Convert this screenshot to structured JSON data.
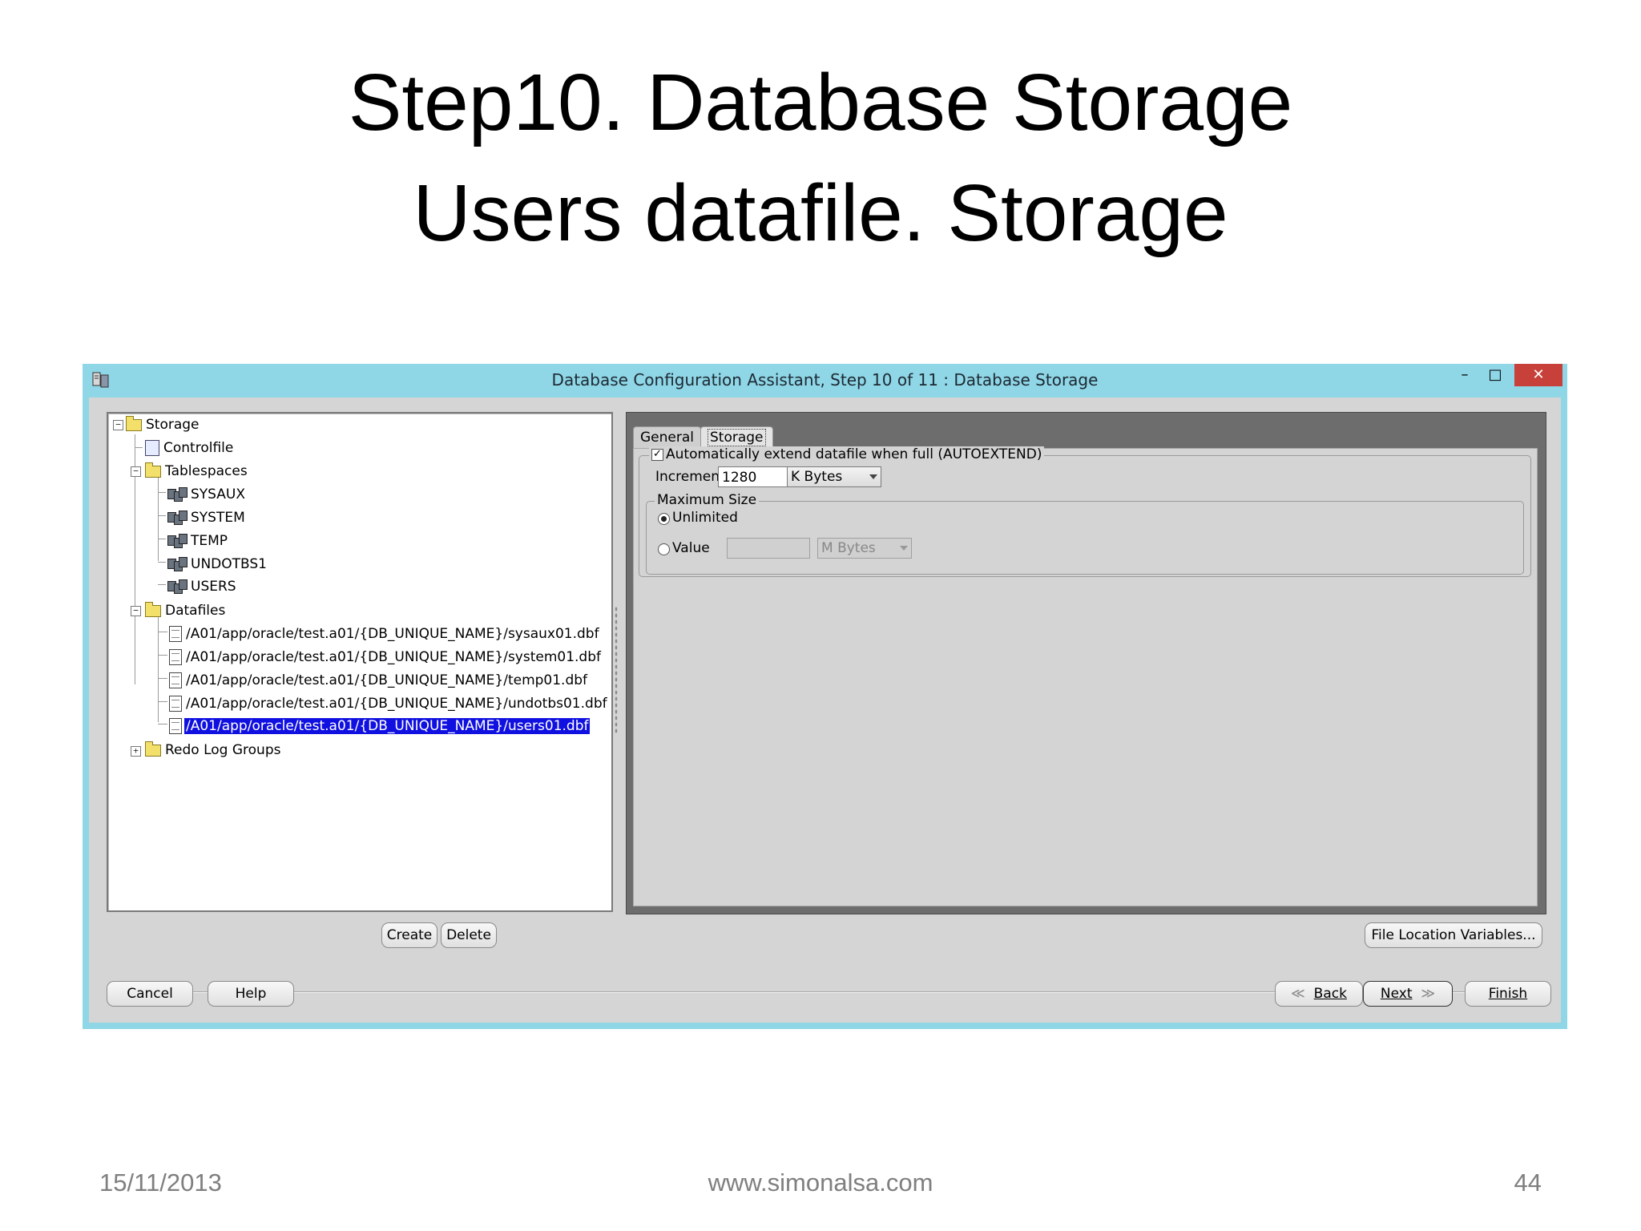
{
  "slide": {
    "title_line1": "Step10. Database Storage",
    "title_line2": "Users datafile. Storage",
    "footer_date": "15/11/2013",
    "footer_url": "www.simonalsa.com",
    "footer_page": "44"
  },
  "window": {
    "title": "Database Configuration Assistant, Step 10 of 11 : Database Storage",
    "minimize": "–",
    "maximize": "□",
    "close": "✕"
  },
  "tree": {
    "storage": "Storage",
    "controlfile": "Controlfile",
    "tablespaces": "Tablespaces",
    "tablespace_items": [
      "SYSAUX",
      "SYSTEM",
      "TEMP",
      "UNDOTBS1",
      "USERS"
    ],
    "datafiles": "Datafiles",
    "datafile_items": [
      "/A01/app/oracle/test.a01/{DB_UNIQUE_NAME}/sysaux01.dbf",
      "/A01/app/oracle/test.a01/{DB_UNIQUE_NAME}/system01.dbf",
      "/A01/app/oracle/test.a01/{DB_UNIQUE_NAME}/temp01.dbf",
      "/A01/app/oracle/test.a01/{DB_UNIQUE_NAME}/undotbs01.dbf",
      "/A01/app/oracle/test.a01/{DB_UNIQUE_NAME}/users01.dbf"
    ],
    "selected_datafile": "/A01/app/oracle/test.a01/{DB_UNIQUE_NAME}/users01.dbf",
    "redo_log_groups": "Redo Log Groups"
  },
  "tabs": {
    "general": "General",
    "storage": "Storage",
    "active": "Storage"
  },
  "storage_tab": {
    "autoextend_label": "Automatically extend datafile when full (AUTOEXTEND)",
    "autoextend_checked": true,
    "increment_label": "Increment:",
    "increment_value": "1280",
    "increment_unit": "K Bytes",
    "max_size_legend": "Maximum Size",
    "unlimited_label": "Unlimited",
    "unlimited_selected": true,
    "value_label": "Value",
    "value_value": "",
    "value_unit": "M Bytes"
  },
  "buttons": {
    "create": "Create",
    "delete": "Delete",
    "file_location_variables": "File Location Variables...",
    "cancel": "Cancel",
    "help": "Help",
    "back": "Back",
    "next": "Next",
    "finish": "Finish"
  },
  "colors": {
    "window_frame": "#8fd6e6",
    "selection": "#1010e0",
    "close_button": "#c7403a"
  }
}
